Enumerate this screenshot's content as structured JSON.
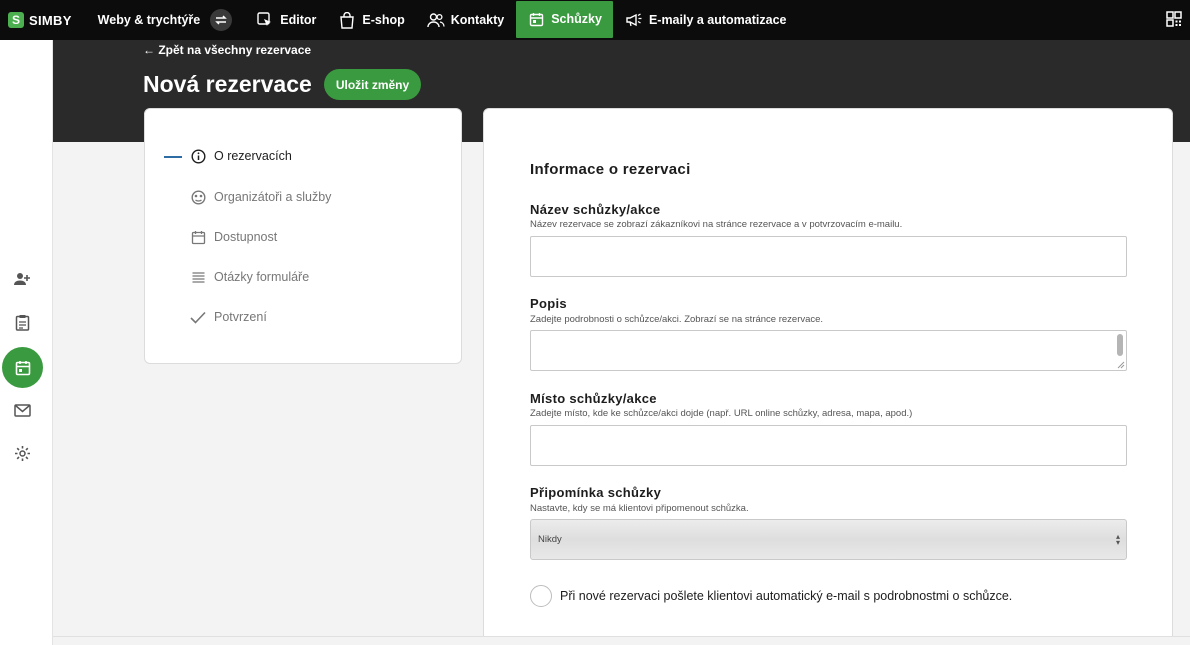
{
  "topnav": {
    "logo_text": "SIMBY",
    "logo_letter": "S",
    "items": [
      {
        "label": "Weby & trychtýře",
        "icon": "none"
      },
      {
        "label": "Editor",
        "icon": "editor-icon"
      },
      {
        "label": "E-shop",
        "icon": "shopping-bag-icon"
      },
      {
        "label": "Kontakty",
        "icon": "contacts-icon"
      },
      {
        "label": "Schůzky",
        "icon": "calendar-icon"
      },
      {
        "label": "E-maily a automatizace",
        "icon": "megaphone-icon"
      }
    ],
    "active_item": "Schůzky",
    "accent_color": "#3a9a3f"
  },
  "header": {
    "back_link": "← Zpět na všechny rezervace",
    "title": "Nová rezervace",
    "save_button": "Uložit změny"
  },
  "steps": [
    {
      "label": "O rezervacích",
      "icon": "info-icon",
      "active": true
    },
    {
      "label": "Organizátoři a služby",
      "icon": "organizers-icon",
      "active": false
    },
    {
      "label": "Dostupnost",
      "icon": "calendar-icon",
      "active": false
    },
    {
      "label": "Otázky formuláře",
      "icon": "list-icon",
      "active": false
    },
    {
      "label": "Potvrzení",
      "icon": "checkmark-icon",
      "active": false
    }
  ],
  "form": {
    "section_title": "Informace o rezervaci",
    "name_label": "Název schůzky/akce",
    "name_hint": "Název rezervace se zobrazí zákazníkovi na stránce rezervace a v potvrzovacím e-mailu.",
    "name_value": "",
    "description_label": "Popis",
    "description_hint": "Zadejte podrobnosti o schůzce/akci. Zobrazí se na stránce rezervace.",
    "description_value": "",
    "location_label": "Místo schůzky/akce",
    "location_hint": "Zadejte místo, kde ke schůzce/akci dojde (např. URL online schůzky, adresa, mapa, apod.)",
    "location_value": "",
    "reminder_label": "Připomínka schůzky",
    "reminder_hint": "Nastavte, kdy se má klientovi připomenout schůzka.",
    "reminder_selected": "Nikdy",
    "auto_email_label": "Při nové rezervaci pošlete klientovi automatický e-mail s podrobnostmi o schůzce.",
    "auto_email_checked": false
  }
}
